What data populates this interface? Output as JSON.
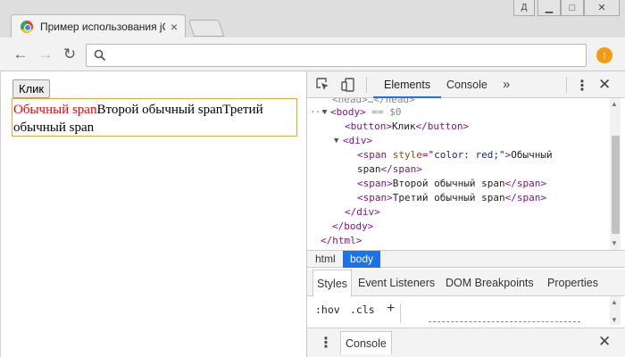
{
  "window": {
    "user_button": "Д",
    "minimize_label": "▁",
    "maximize_label": "□",
    "close_label": "✕"
  },
  "tab": {
    "title": "Пример использования jQuery",
    "close": "×"
  },
  "toolbar": {
    "back": "←",
    "forward": "→",
    "reload": "↻",
    "address": "",
    "extension_badge": "↑"
  },
  "page": {
    "button_label": "Клик",
    "span_red": "Обычный span",
    "span_2": "Второй обычный span",
    "span_3": "Третий обычный span"
  },
  "devtools": {
    "tabs": {
      "elements": "Elements",
      "console": "Console",
      "more": "»"
    },
    "kebab": "⋮",
    "close": "✕",
    "dom": {
      "head_partial": "<head>…</head>",
      "body_open": "<body>",
      "body_equals": "== $0",
      "button_line": {
        "open": "<button>",
        "text": "Клик",
        "close": "</button>"
      },
      "div_open": "<div>",
      "span1": {
        "open_start": "<span ",
        "attr_name": "style",
        "attr_value": "\"color: red;\"",
        "open_end": ">",
        "text_a": "Обычный",
        "text_b": "span",
        "close": "</span>"
      },
      "span2": {
        "open": "<span>",
        "text": "Второй обычный span",
        "close": "</span>"
      },
      "span3": {
        "open": "<span>",
        "text": "Третий обычный span",
        "close": "</span>"
      },
      "div_close": "</div>",
      "body_close": "</body>",
      "html_close": "</html>"
    },
    "breadcrumbs": [
      "html",
      "body"
    ],
    "styles_tabs": [
      "Styles",
      "Event Listeners",
      "DOM Breakpoints",
      "Properties"
    ],
    "styles_toolbar": {
      "hov": ":hov",
      "cls": ".cls",
      "add": "+"
    },
    "drawer": {
      "tab": "Console",
      "close": "✕",
      "kebab": "⋮"
    }
  }
}
